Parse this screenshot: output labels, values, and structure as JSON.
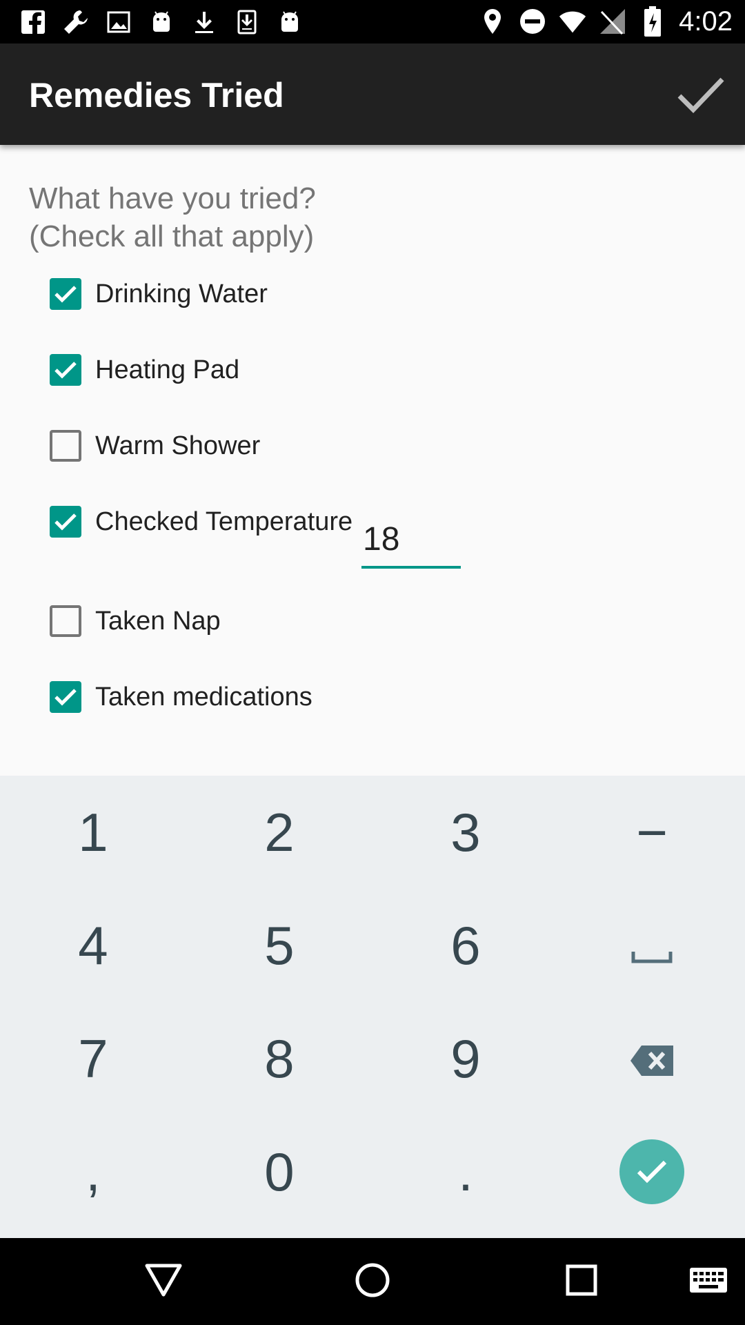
{
  "status_bar": {
    "left_icons": [
      "facebook-icon",
      "wrench-icon",
      "image-icon",
      "android-icon",
      "download-icon",
      "download-box-icon",
      "android-icon"
    ],
    "right_icons": [
      "location-icon",
      "do-not-disturb-icon",
      "wifi-icon",
      "no-sim-icon",
      "battery-charging-icon"
    ],
    "time": "4:02"
  },
  "app_bar": {
    "title": "Remedies Tried",
    "confirm_icon": "check-icon"
  },
  "form": {
    "question_line1": "What have you tried?",
    "question_line2": "(Check all that apply)",
    "options": [
      {
        "label": "Drinking Water",
        "checked": true
      },
      {
        "label": "Heating Pad",
        "checked": true
      },
      {
        "label": "Warm Shower",
        "checked": false
      },
      {
        "label": "Checked Temperature",
        "checked": true
      },
      {
        "label": "Taken Nap",
        "checked": false
      },
      {
        "label": "Taken medications",
        "checked": true
      }
    ],
    "temperature_value": "18"
  },
  "keyboard": {
    "keys": [
      "1",
      "2",
      "3",
      "−",
      "4",
      "5",
      "6",
      "space-icon",
      "7",
      "8",
      "9",
      "backspace-icon",
      ",",
      "0",
      ".",
      "enter-check-icon"
    ],
    "row1": [
      "1",
      "2",
      "3",
      "−"
    ],
    "row2": [
      "4",
      "5",
      "6"
    ],
    "row3": [
      "7",
      "8",
      "9"
    ],
    "row4": [
      ",",
      "0",
      "."
    ]
  },
  "nav_bar": {
    "icons": [
      "back-icon",
      "home-icon",
      "recents-icon",
      "keyboard-icon"
    ]
  },
  "colors": {
    "accent": "#009688",
    "appbar": "#212121",
    "keyboard_bg": "#eceff1",
    "enter_key": "#4db6ac"
  }
}
